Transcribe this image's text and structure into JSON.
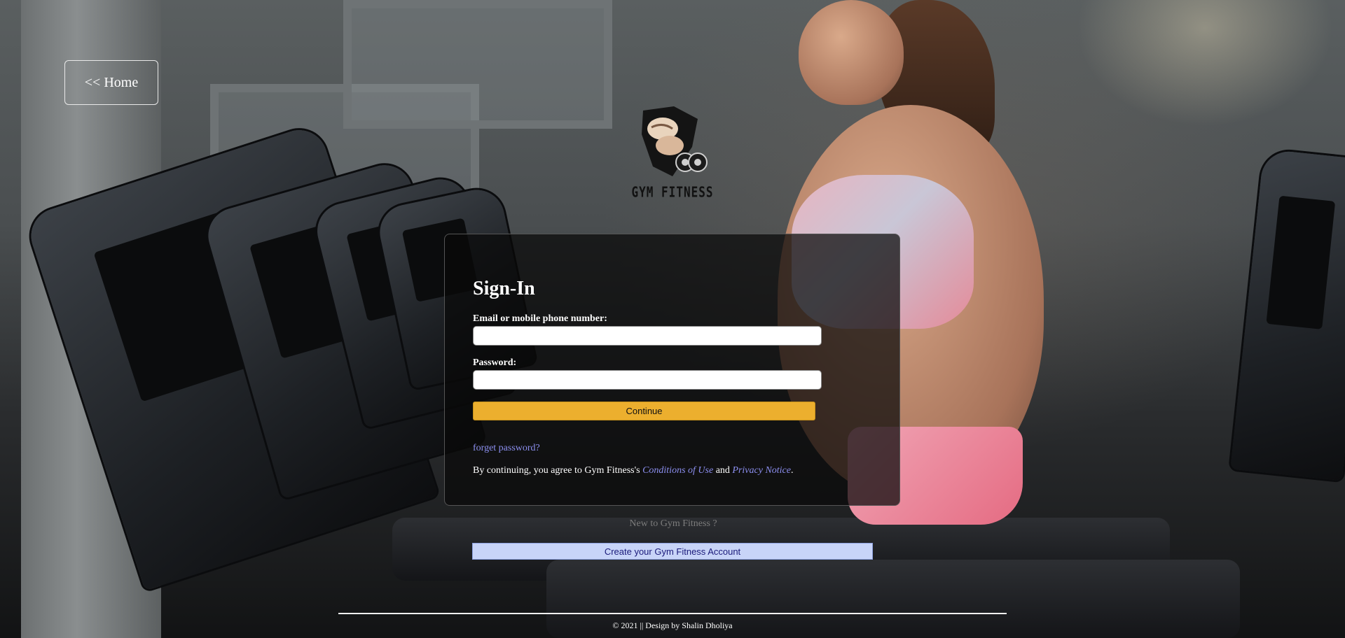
{
  "nav": {
    "home_label": "<< Home"
  },
  "brand": {
    "logo_text": "GYM FITNESS"
  },
  "signin": {
    "title": "Sign-In",
    "email_label": "Email or mobile phone number:",
    "email_value": "",
    "password_label": "Password:",
    "password_value": "",
    "continue_label": "Continue",
    "forget_label": "forget password?",
    "agree_prefix": "By continuing, you agree to Gym Fitness's ",
    "conditions_label": "Conditions of Use",
    "agree_and": " and ",
    "privacy_label": "Privacy Notice",
    "agree_suffix": "."
  },
  "register": {
    "new_to": "New to Gym Fitness ?",
    "create_label": "Create your Gym Fitness Account"
  },
  "footer": {
    "text": "© 2021 || Design by Shalin Dholiya"
  },
  "colors": {
    "accent_button": "#ecaf2e",
    "link": "#8c8ff0",
    "create_button": "#c8d4f8",
    "card_bg": "rgba(8,8,8,0.72)"
  }
}
